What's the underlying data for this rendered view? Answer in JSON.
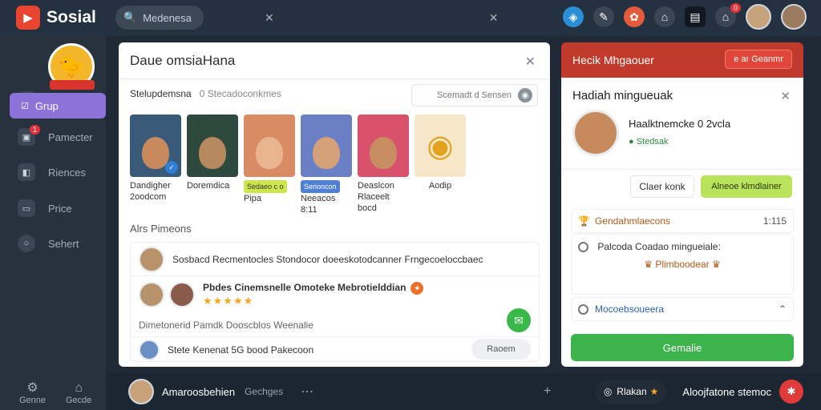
{
  "app": {
    "name": "Sosial"
  },
  "search": {
    "value": "Medenesa",
    "clear_icon": "close-icon"
  },
  "topbar": {
    "notification_count": "0"
  },
  "sidebar": {
    "active_label": "Grup",
    "items": [
      {
        "label": "Pamecter",
        "badge": "1"
      },
      {
        "label": "Riences"
      },
      {
        "label": "Price"
      },
      {
        "label": "Sehert"
      }
    ],
    "bottom": [
      {
        "label": "Genne"
      },
      {
        "label": "Gecde"
      }
    ]
  },
  "main": {
    "title": "Daue omsiaHana",
    "subtitle_left": "Stelupdemsna",
    "subtitle_right": "0 Stecadoconkmes",
    "search_label": "Scemadt d Sensen",
    "cards": [
      {
        "line1": "Dandigher",
        "line2": "2oodcom"
      },
      {
        "line1": "Doremdica",
        "line2": ""
      },
      {
        "line1": "Sedaeo c o",
        "line2": "Pipa",
        "tag": "green"
      },
      {
        "line1": "Serioncon",
        "line2": "Neeacos",
        "line3": "8:11",
        "tag": "blue"
      },
      {
        "line1": "Deaslcon",
        "line2": "Rlaceelt bocd"
      },
      {
        "line1": "Aodip",
        "line2": ""
      }
    ],
    "section_title": "Alrs Pimeons",
    "list": {
      "row1": "Sosbacd Recmentocles  Stondocor doeeskotodcanner  Frngecoeloccbaec",
      "row2_title": "Pbdes Cinemsnelle Omoteke Mebrotielddian",
      "row2_stars": "★★★★★",
      "row3": "Dimetonerid  Pamdk Dooscblos  Weenalie",
      "row4": "Stete Kenenat 5G bood Pakecoon",
      "pill": "Raoem"
    }
  },
  "right": {
    "header": "Hecik Mhgaouer",
    "header_button": "e ar Geanmr",
    "title": "Hadiah mingueuak",
    "name": "Haalktnemcke 0 2vcla",
    "status": "Stedsak",
    "clear": "Claer konk",
    "accept": "Alneoe klmdlainer",
    "section": "Gendahmlaecons",
    "section_right": "1:115",
    "option1": "Palcoda Coadao mingueiale:",
    "option1_tag": "Plimboodear",
    "option2": "Mocoebsoueera",
    "confirm": "Gemalie"
  },
  "bottombar": {
    "name": "Amaroosbehien",
    "subtext": "Gechges",
    "chip": "Rlakan",
    "right_text": "Aloojfatone stemoc"
  },
  "colors": {
    "brand": "#e8442f",
    "accent": "#8b73d9",
    "confirm": "#3cb44b",
    "header_red": "#c23a2c"
  }
}
